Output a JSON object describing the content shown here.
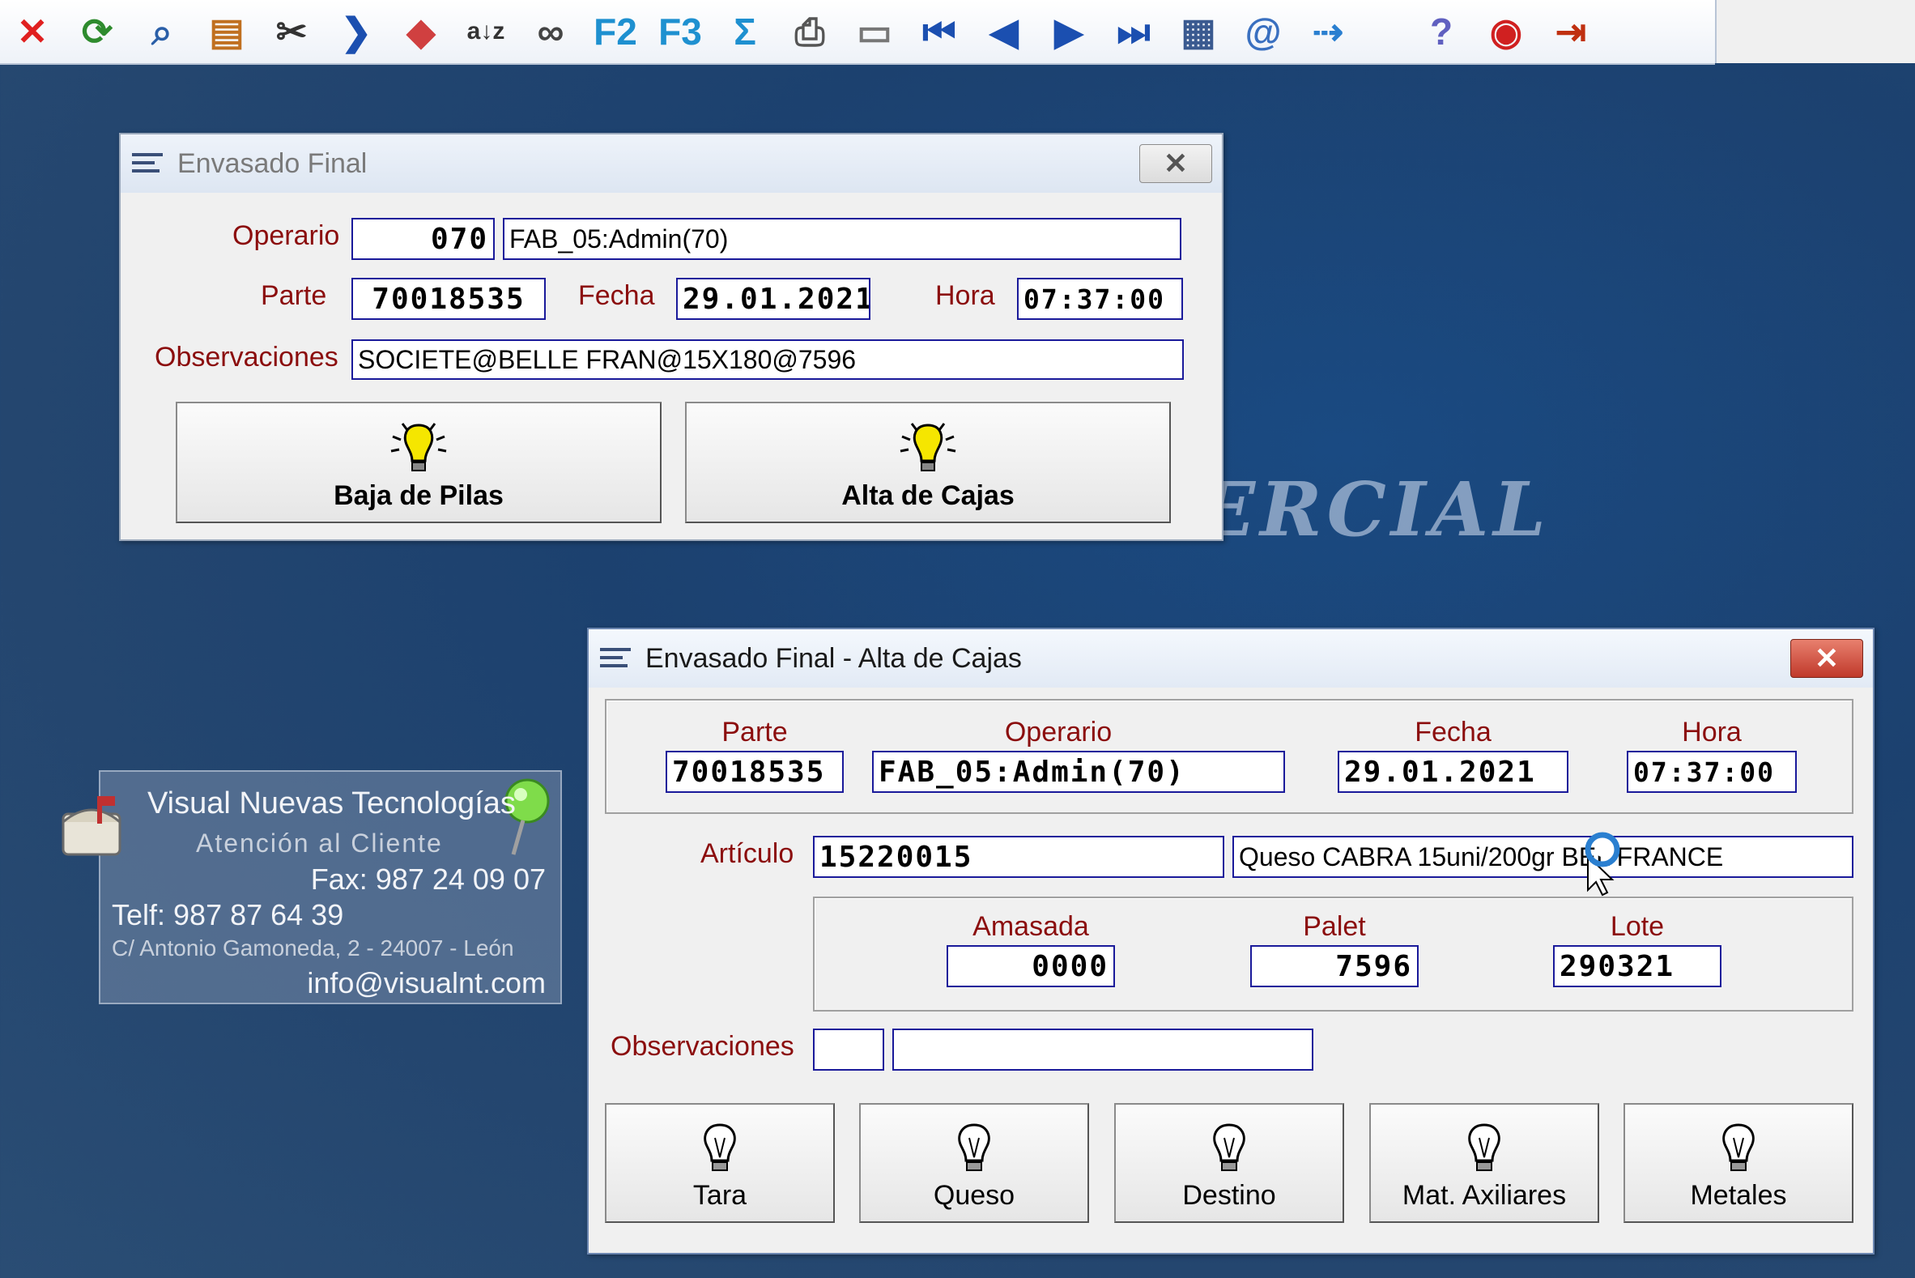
{
  "toolbar": {
    "icons": [
      "close-x-icon",
      "refresh-icon",
      "search-icon",
      "document-icon",
      "tools-icon",
      "next-chevron-icon",
      "book-icon",
      "sort-az-icon",
      "binoculars-icon",
      "F2",
      "F3",
      "Σ",
      "printer-icon",
      "usb-icon",
      "first-record-icon",
      "previous-record-icon",
      "next-record-icon",
      "last-record-icon",
      "calculator-icon",
      "email-icon",
      "export-icon",
      "help-icon",
      "about-icon",
      "exit-icon"
    ]
  },
  "background": {
    "watermark": "ERCIAL"
  },
  "win1": {
    "title": "Envasado Final",
    "operario_label": "Operario",
    "operario_code": "070",
    "operario_name": "FAB_05:Admin(70)",
    "parte_label": "Parte",
    "parte_value": "70018535",
    "fecha_label": "Fecha",
    "fecha_value": "29.01.2021",
    "hora_label": "Hora",
    "hora_value": "07:37:00",
    "observaciones_label": "Observaciones",
    "observaciones_value": "SOCIETE@BELLE FRAN@15X180@7596",
    "btn_baja": "Baja de Pilas",
    "btn_alta": "Alta de Cajas"
  },
  "win2": {
    "title": "Envasado Final - Alta de Cajas",
    "parte_label": "Parte",
    "parte_value": "70018535",
    "operario_label": "Operario",
    "operario_value": "FAB_05:Admin(70)",
    "fecha_label": "Fecha",
    "fecha_value": "29.01.2021",
    "hora_label": "Hora",
    "hora_value": "07:37:00",
    "articulo_label": "Artículo",
    "articulo_code": "15220015",
    "articulo_desc": "Queso CABRA 15uni/200gr BEL   FRANCE",
    "amasada_label": "Amasada",
    "amasada_value": "0000",
    "palet_label": "Palet",
    "palet_value": "7596",
    "lote_label": "Lote",
    "lote_value": "290321",
    "observaciones_label": "Observaciones",
    "obs_code": "",
    "obs_text": "",
    "buttons": [
      "Tara",
      "Queso",
      "Destino",
      "Mat. Axiliares",
      "Metales"
    ]
  },
  "support": {
    "company": "Visual Nuevas Tecnologías",
    "subtitle": "Atención al Cliente",
    "fax": "Fax: 987 24 09 07",
    "telf": "Telf: 987 87 64 39",
    "address": "C/ Antonio Gamoneda, 2 - 24007 - León",
    "email": "info@visualnt.com"
  }
}
